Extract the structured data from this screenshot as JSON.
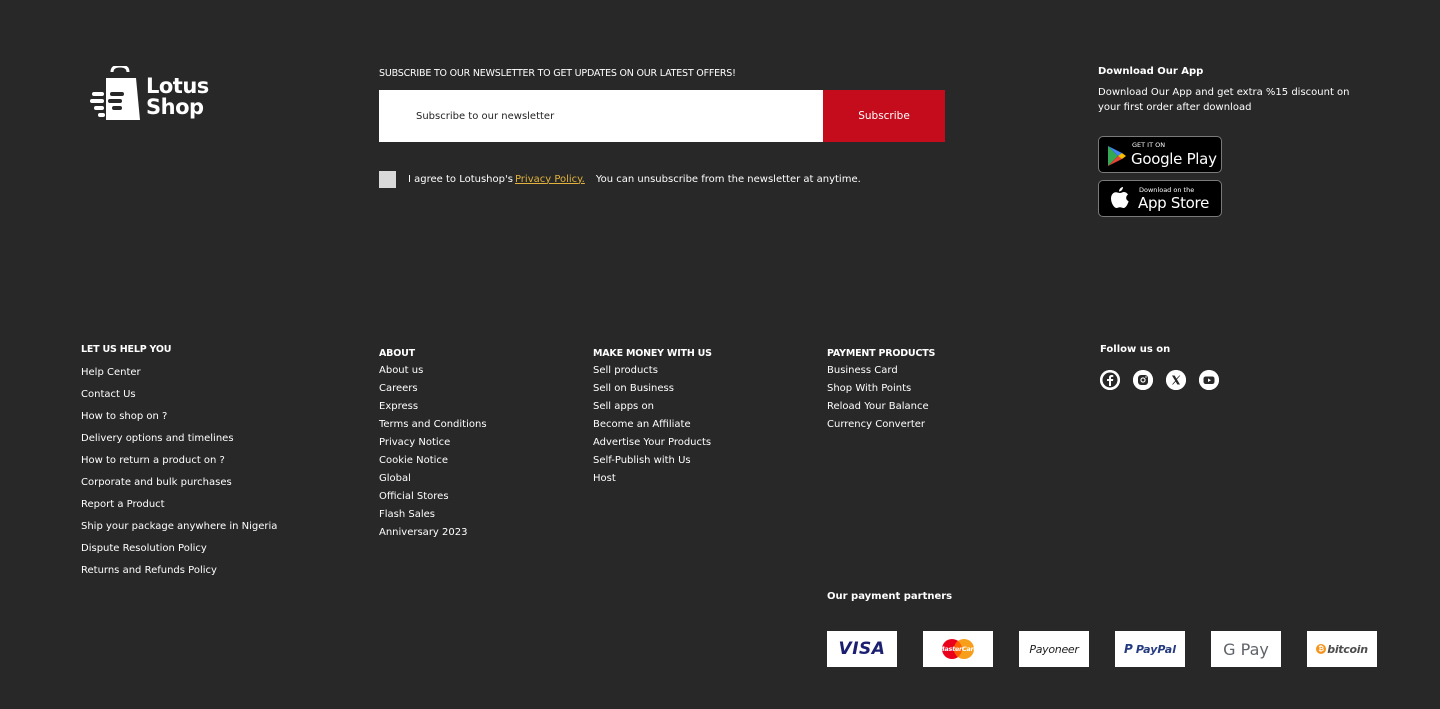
{
  "brand": {
    "name_line1": "Lotus",
    "name_line2": "Shop"
  },
  "newsletter": {
    "title": "SUBSCRIBE TO OUR NEWSLETTER TO GET UPDATES ON OUR LATEST OFFERS!",
    "placeholder": "Subscribe to our newsletter",
    "button": "Subscribe",
    "agree_prefix": "I agree to Lotushop's",
    "privacy_link": "Privacy Policy.",
    "unsubscribe_note": "You can unsubscribe from the newsletter at anytime."
  },
  "app": {
    "title": "Download Our App",
    "description": "Download Our App and get extra %15 discount on your first order after download",
    "google_small": "GET IT ON",
    "google_big": "Google Play",
    "apple_small": "Download on the",
    "apple_big": "App Store"
  },
  "help": {
    "heading": "LET US HELP YOU",
    "items": [
      "Help Center",
      "Contact Us",
      "How to shop on ?",
      "Delivery options and timelines",
      "How to return a product on ?",
      "Corporate and bulk purchases",
      "Report a Product",
      "Ship your package anywhere in Nigeria",
      "Dispute Resolution Policy",
      "Returns and Refunds Policy"
    ]
  },
  "about": {
    "heading": "ABOUT",
    "items": [
      "About us",
      "Careers",
      "Express",
      "Terms and Conditions",
      "Privacy Notice",
      "Cookie Notice",
      "Global",
      "Official Stores",
      "Flash Sales",
      "Anniversary 2023"
    ]
  },
  "money": {
    "heading": "MAKE MONEY WITH US",
    "items": [
      "Sell products",
      "Sell on Business",
      "Sell apps on",
      "Become an Affiliate",
      "Advertise Your Products",
      "Self-Publish with Us",
      "Host"
    ]
  },
  "payment": {
    "heading": "PAYMENT PRODUCTS",
    "items": [
      "Business Card",
      "Shop With Points",
      "Reload Your Balance",
      "Currency Converter"
    ]
  },
  "follow": {
    "title": "Follow us on",
    "icons": [
      "facebook-icon",
      "instagram-icon",
      "x-icon",
      "youtube-icon"
    ]
  },
  "partners": {
    "title": "Our payment partners",
    "items": [
      {
        "label": "VISA",
        "color": "#1a1f71"
      },
      {
        "label": "MasterCard",
        "color": "#eb001b"
      },
      {
        "label": "Payoneer",
        "color": "#222222"
      },
      {
        "label": "PayPal",
        "color": "#253b80"
      },
      {
        "label": "G Pay",
        "color": "#5f6368"
      },
      {
        "label": "bitcoin",
        "color": "#4d4d4d"
      }
    ]
  },
  "colors": {
    "background": "#282828",
    "subscribe": "#c50c1c",
    "link": "#e2b23d"
  }
}
